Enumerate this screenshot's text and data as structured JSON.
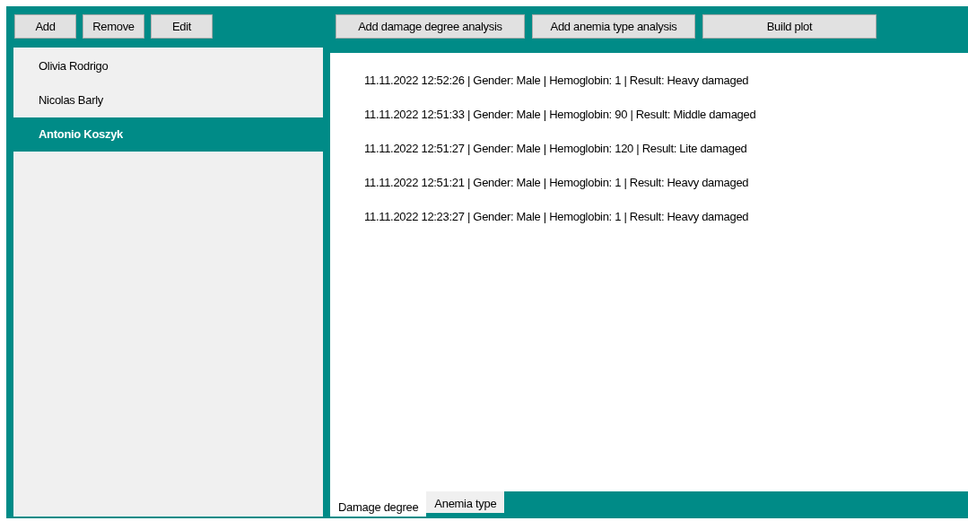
{
  "patient_buttons": [
    "Add",
    "Remove",
    "Edit"
  ],
  "analysis_buttons": [
    "Add damage degree analysis",
    "Add anemia type analysis",
    "Build plot"
  ],
  "patients": [
    {
      "name": "Olivia Rodrigo",
      "selected": false
    },
    {
      "name": "Nicolas Barly",
      "selected": false
    },
    {
      "name": "Antonio Koszyk",
      "selected": true
    }
  ],
  "results": [
    "11.11.2022 12:52:26 | Gender: Male | Hemoglobin: 1 | Result: Heavy damaged",
    "11.11.2022 12:51:33 | Gender: Male | Hemoglobin: 90 | Result: Middle damaged",
    "11.11.2022 12:51:27 | Gender: Male | Hemoglobin: 120 | Result: Lite damaged",
    "11.11.2022 12:51:21 | Gender: Male | Hemoglobin: 1 | Result: Heavy damaged",
    "11.11.2022 12:23:27 | Gender: Male | Hemoglobin: 1 | Result: Heavy damaged"
  ],
  "tabs": [
    {
      "label": "Damage degree",
      "selected": true
    },
    {
      "label": "Anemia type",
      "selected": false
    }
  ]
}
